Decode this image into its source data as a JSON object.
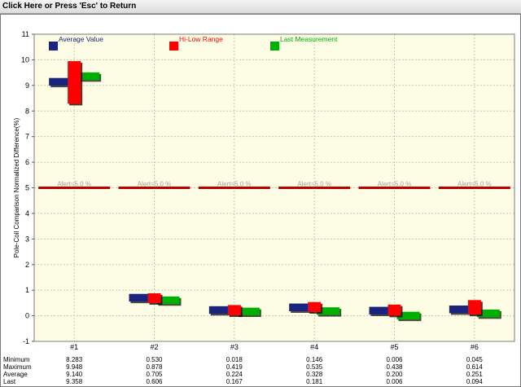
{
  "window": {
    "title": "Click Here or Press 'Esc' to Return"
  },
  "chart_data": {
    "type": "bar",
    "ylabel": "Pole-Coil Comparison Normalized Difference(%)",
    "ylim": [
      -1,
      11
    ],
    "yticks": [
      -1,
      0,
      1,
      2,
      3,
      4,
      5,
      6,
      7,
      8,
      9,
      10,
      11
    ],
    "grid": true,
    "legend_placement": "top",
    "categories": [
      "#1",
      "#2",
      "#3",
      "#4",
      "#5",
      "#6"
    ],
    "alert": {
      "value": 5.0,
      "label": "Alert=5.0 %"
    },
    "series": [
      {
        "name": "Average Value",
        "color": "#1a237e",
        "values": [
          9.14,
          0.705,
          0.224,
          0.328,
          0.2,
          0.251
        ]
      },
      {
        "name": "Hi-Low Range",
        "color": "#ff0000",
        "low": [
          8.283,
          0.53,
          0.018,
          0.146,
          0.006,
          0.045
        ],
        "high": [
          9.948,
          0.878,
          0.419,
          0.535,
          0.438,
          0.614
        ]
      },
      {
        "name": "Last Measurement",
        "color": "#00b000",
        "values": [
          9.358,
          0.606,
          0.167,
          0.181,
          0.006,
          0.094
        ]
      }
    ],
    "table": {
      "row_labels": [
        "Minimum",
        "Maximum",
        "Average",
        "Last"
      ],
      "rows": [
        [
          "8.283",
          "0.530",
          "0.018",
          "0.146",
          "0.006",
          "0.045"
        ],
        [
          "9.948",
          "0.878",
          "0.419",
          "0.535",
          "0.438",
          "0.614"
        ],
        [
          "9.140",
          "0.705",
          "0.224",
          "0.328",
          "0.200",
          "0.251"
        ],
        [
          "9.358",
          "0.606",
          "0.167",
          "0.181",
          "0.006",
          "0.094"
        ]
      ]
    }
  }
}
